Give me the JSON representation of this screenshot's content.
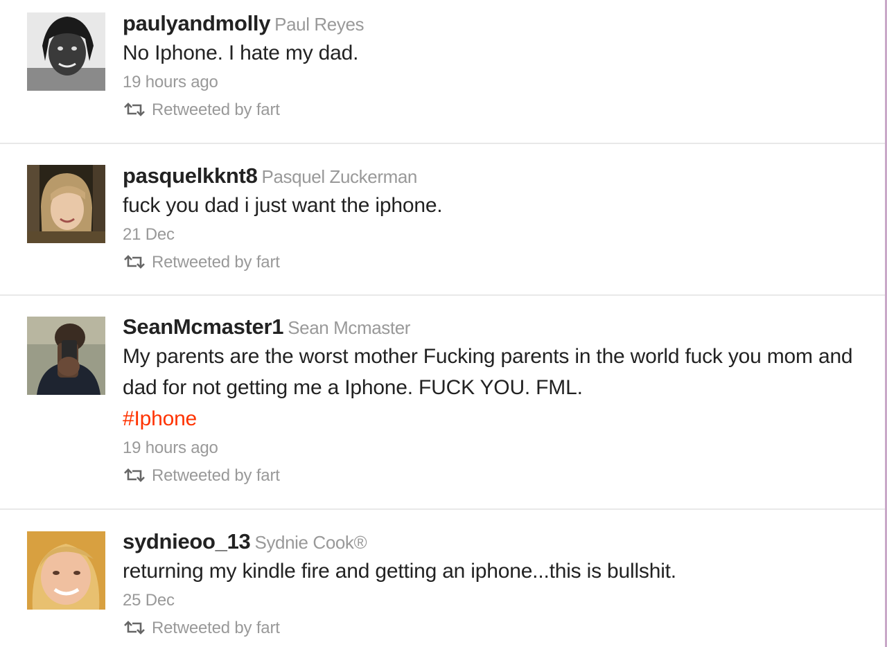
{
  "tweets": [
    {
      "screen_name": "paulyandmolly",
      "full_name": "Paul Reyes",
      "text": "No Iphone. I hate my dad.",
      "hashtag": "",
      "timestamp": "19 hours ago",
      "retweeted_by": "Retweeted by fart"
    },
    {
      "screen_name": "pasquelkknt8",
      "full_name": "Pasquel Zuckerman",
      "text": "fuck you dad i just want the iphone.",
      "hashtag": "",
      "timestamp": "21 Dec",
      "retweeted_by": "Retweeted by fart"
    },
    {
      "screen_name": "SeanMcmaster1",
      "full_name": "Sean Mcmaster",
      "text": "My parents are the worst mother Fucking parents in the world fuck you mom and dad for not getting me a Iphone. FUCK YOU. FML.",
      "hashtag": "#Iphone",
      "timestamp": "19 hours ago",
      "retweeted_by": "Retweeted by fart"
    },
    {
      "screen_name": "sydnieoo_13",
      "full_name": "Sydnie Cook®",
      "text": "returning my kindle fire and getting an iphone...this is bullshit.",
      "hashtag": "",
      "timestamp": "25 Dec",
      "retweeted_by": "Retweeted by fart"
    }
  ],
  "icons": {
    "retweet": "retweet-icon",
    "avatar": "avatar"
  },
  "colors": {
    "hashtag": "#ff3300",
    "muted": "#999999",
    "text": "#222222",
    "divider": "#e8e8e8"
  }
}
